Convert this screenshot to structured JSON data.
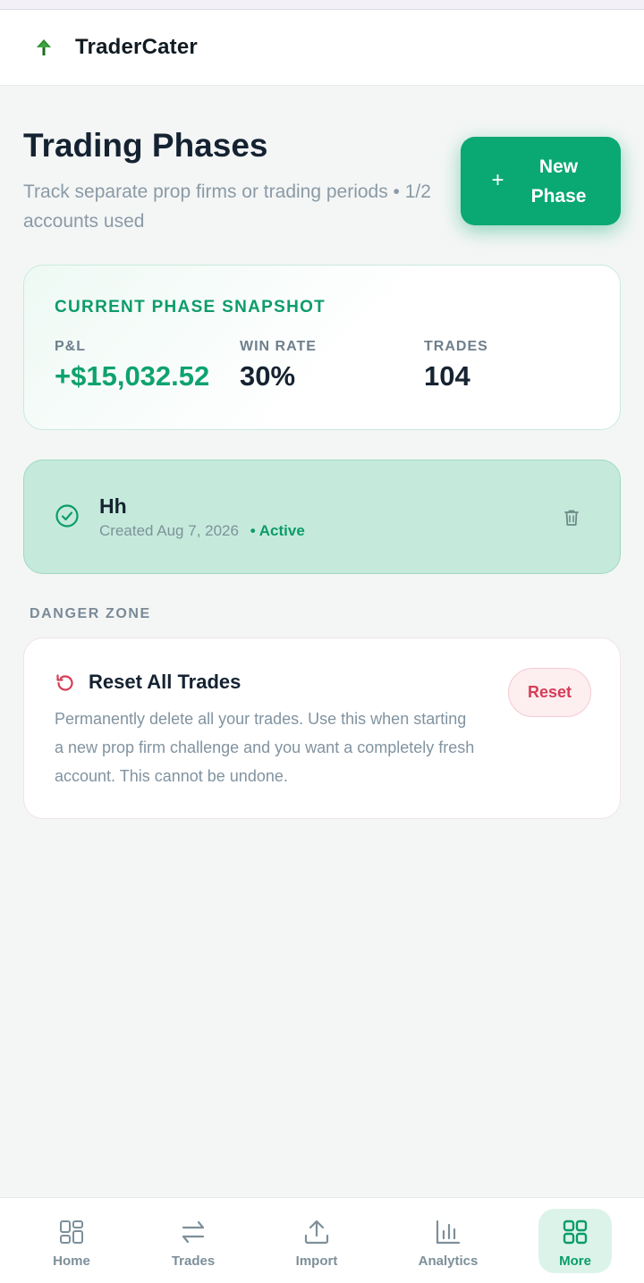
{
  "app": {
    "brand": "TraderCater"
  },
  "header": {
    "title": "Trading Phases",
    "subtitle": "Track separate prop firms or trading periods • 1/2 accounts used",
    "new_button_label": "New Phase"
  },
  "snapshot": {
    "title": "CURRENT PHASE SNAPSHOT",
    "stats": [
      {
        "label": "P&L",
        "value": "+$15,032.52"
      },
      {
        "label": "WIN RATE",
        "value": "30%"
      },
      {
        "label": "TRADES",
        "value": "104"
      }
    ]
  },
  "phases": [
    {
      "name": "Hh",
      "created": "Created Aug 7, 2026",
      "status": "• Active"
    }
  ],
  "danger_zone": {
    "label": "DANGER ZONE",
    "title": "Reset All Trades",
    "description": "Permanently delete all your trades. Use this when starting a new prop firm challenge and you want a completely fresh account. This cannot be undone.",
    "button_label": "Reset"
  },
  "bottom_nav": {
    "items": [
      {
        "label": "Home",
        "icon": "home-grid-icon"
      },
      {
        "label": "Trades",
        "icon": "arrows-swap-icon"
      },
      {
        "label": "Import",
        "icon": "upload-icon"
      },
      {
        "label": "Analytics",
        "icon": "bar-chart-icon"
      },
      {
        "label": "More",
        "icon": "apps-grid-icon",
        "active": true
      }
    ]
  },
  "colors": {
    "accent": "#0aa872",
    "danger": "#d63d58",
    "active_card": "#c5eadc"
  }
}
